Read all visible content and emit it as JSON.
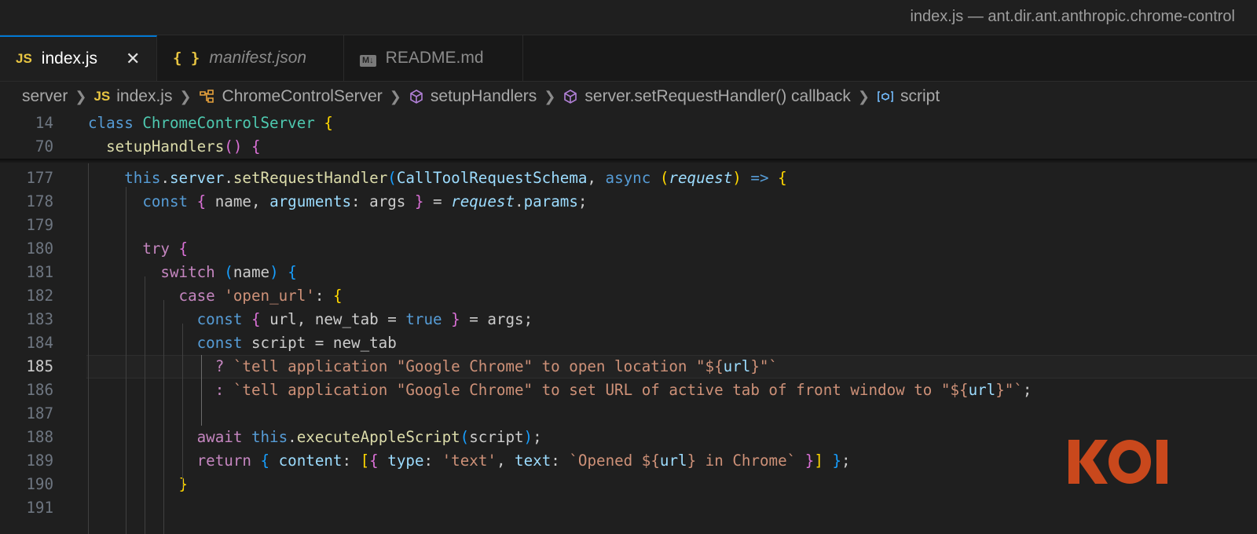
{
  "window": {
    "title": "index.js — ant.dir.ant.anthropic.chrome-control"
  },
  "tabs": [
    {
      "icon": "JS",
      "icon_name": "javascript-file-icon",
      "label": "index.js",
      "active": true,
      "close": "✕"
    },
    {
      "icon": "{ }",
      "icon_name": "json-file-icon",
      "label": "manifest.json",
      "active": false
    },
    {
      "icon": "M↓",
      "icon_name": "markdown-file-icon",
      "label": "README.md",
      "active": false
    }
  ],
  "breadcrumb": [
    {
      "label": "server",
      "icon": "folder"
    },
    {
      "label": "index.js",
      "icon": "javascript-file-icon",
      "icon_text": "JS"
    },
    {
      "label": "ChromeControlServer",
      "icon": "class-icon"
    },
    {
      "label": "setupHandlers",
      "icon": "method-icon"
    },
    {
      "label": "server.setRequestHandler() callback",
      "icon": "method-icon"
    },
    {
      "label": "script",
      "icon": "variable-icon"
    }
  ],
  "editor": {
    "current_line": 185,
    "sticky_lines": [
      {
        "number": "14",
        "tokens": [
          {
            "t": "class ",
            "c": "kw"
          },
          {
            "t": "ChromeControlServer",
            "c": "cls"
          },
          {
            "t": " "
          },
          {
            "t": "{",
            "c": "br1"
          }
        ]
      },
      {
        "number": "70",
        "tokens": [
          {
            "t": "  "
          },
          {
            "t": "setupHandlers",
            "c": "fn"
          },
          {
            "t": "()",
            "c": "br2"
          },
          {
            "t": " "
          },
          {
            "t": "{",
            "c": "br2"
          }
        ]
      }
    ],
    "lines": [
      {
        "number": "177",
        "tokens": [
          {
            "t": "    "
          },
          {
            "t": "this",
            "c": "kw"
          },
          {
            "t": "."
          },
          {
            "t": "server",
            "c": "prop"
          },
          {
            "t": "."
          },
          {
            "t": "setRequestHandler",
            "c": "fn"
          },
          {
            "t": "(",
            "c": "br3"
          },
          {
            "t": "CallToolRequestSchema",
            "c": "prop"
          },
          {
            "t": ", "
          },
          {
            "t": "async",
            "c": "kw"
          },
          {
            "t": " "
          },
          {
            "t": "(",
            "c": "br1"
          },
          {
            "t": "request",
            "c": "prop it"
          },
          {
            "t": ")",
            "c": "br1"
          },
          {
            "t": " => ",
            "c": "kw"
          },
          {
            "t": "{",
            "c": "br1"
          }
        ]
      },
      {
        "number": "178",
        "tokens": [
          {
            "t": "      "
          },
          {
            "t": "const",
            "c": "kw"
          },
          {
            "t": " "
          },
          {
            "t": "{",
            "c": "br2"
          },
          {
            "t": " name, "
          },
          {
            "t": "arguments",
            "c": "prop"
          },
          {
            "t": ": args "
          },
          {
            "t": "}",
            "c": "br2"
          },
          {
            "t": " = "
          },
          {
            "t": "request",
            "c": "prop it"
          },
          {
            "t": "."
          },
          {
            "t": "params",
            "c": "prop"
          },
          {
            "t": ";"
          }
        ]
      },
      {
        "number": "179",
        "tokens": []
      },
      {
        "number": "180",
        "tokens": [
          {
            "t": "      "
          },
          {
            "t": "try",
            "c": "kc"
          },
          {
            "t": " "
          },
          {
            "t": "{",
            "c": "br2"
          }
        ]
      },
      {
        "number": "181",
        "tokens": [
          {
            "t": "        "
          },
          {
            "t": "switch",
            "c": "kc"
          },
          {
            "t": " "
          },
          {
            "t": "(",
            "c": "br3"
          },
          {
            "t": "name"
          },
          {
            "t": ")",
            "c": "br3"
          },
          {
            "t": " "
          },
          {
            "t": "{",
            "c": "br3"
          }
        ]
      },
      {
        "number": "182",
        "tokens": [
          {
            "t": "          "
          },
          {
            "t": "case",
            "c": "kc"
          },
          {
            "t": " "
          },
          {
            "t": "'open_url'",
            "c": "str"
          },
          {
            "t": ": "
          },
          {
            "t": "{",
            "c": "br1"
          }
        ]
      },
      {
        "number": "183",
        "tokens": [
          {
            "t": "            "
          },
          {
            "t": "const",
            "c": "kw"
          },
          {
            "t": " "
          },
          {
            "t": "{",
            "c": "br2"
          },
          {
            "t": " url, new_tab = "
          },
          {
            "t": "true",
            "c": "kw"
          },
          {
            "t": " "
          },
          {
            "t": "}",
            "c": "br2"
          },
          {
            "t": " = args;"
          }
        ]
      },
      {
        "number": "184",
        "tokens": [
          {
            "t": "            "
          },
          {
            "t": "const",
            "c": "kw"
          },
          {
            "t": " script = new_tab"
          }
        ]
      },
      {
        "number": "185",
        "tokens": [
          {
            "t": "              "
          },
          {
            "t": "?",
            "c": "kc"
          },
          {
            "t": " "
          },
          {
            "t": "`tell application \"Google Chrome\" to open location \"${",
            "c": "str"
          },
          {
            "t": "url",
            "c": "prop"
          },
          {
            "t": "}\"`",
            "c": "str"
          }
        ]
      },
      {
        "number": "186",
        "tokens": [
          {
            "t": "              "
          },
          {
            "t": ":",
            "c": "kc"
          },
          {
            "t": " "
          },
          {
            "t": "`tell application \"Google Chrome\" to set URL of active tab of front window to \"${",
            "c": "str"
          },
          {
            "t": "url",
            "c": "prop"
          },
          {
            "t": "}\"`",
            "c": "str"
          },
          {
            "t": ";"
          }
        ]
      },
      {
        "number": "187",
        "tokens": []
      },
      {
        "number": "188",
        "tokens": [
          {
            "t": "            "
          },
          {
            "t": "await",
            "c": "kc"
          },
          {
            "t": " "
          },
          {
            "t": "this",
            "c": "kw"
          },
          {
            "t": "."
          },
          {
            "t": "executeAppleScript",
            "c": "fn"
          },
          {
            "t": "(",
            "c": "br3"
          },
          {
            "t": "script"
          },
          {
            "t": ")",
            "c": "br3"
          },
          {
            "t": ";"
          }
        ]
      },
      {
        "number": "189",
        "tokens": [
          {
            "t": "            "
          },
          {
            "t": "return",
            "c": "kc"
          },
          {
            "t": " "
          },
          {
            "t": "{",
            "c": "br3"
          },
          {
            "t": " "
          },
          {
            "t": "content",
            "c": "prop"
          },
          {
            "t": ": "
          },
          {
            "t": "[",
            "c": "br1"
          },
          {
            "t": "{",
            "c": "br2"
          },
          {
            "t": " "
          },
          {
            "t": "type",
            "c": "prop"
          },
          {
            "t": ": "
          },
          {
            "t": "'text'",
            "c": "str"
          },
          {
            "t": ", "
          },
          {
            "t": "text",
            "c": "prop"
          },
          {
            "t": ": "
          },
          {
            "t": "`Opened ${",
            "c": "str"
          },
          {
            "t": "url",
            "c": "prop"
          },
          {
            "t": "} in Chrome`",
            "c": "str"
          },
          {
            "t": " "
          },
          {
            "t": "}",
            "c": "br2"
          },
          {
            "t": "]",
            "c": "br1"
          },
          {
            "t": " "
          },
          {
            "t": "}",
            "c": "br3"
          },
          {
            "t": ";"
          }
        ]
      },
      {
        "number": "190",
        "tokens": [
          {
            "t": "          "
          },
          {
            "t": "}",
            "c": "br1"
          }
        ]
      },
      {
        "number": "191",
        "tokens": []
      }
    ]
  },
  "watermark": {
    "text": "KOI",
    "color": "#c9481c"
  }
}
